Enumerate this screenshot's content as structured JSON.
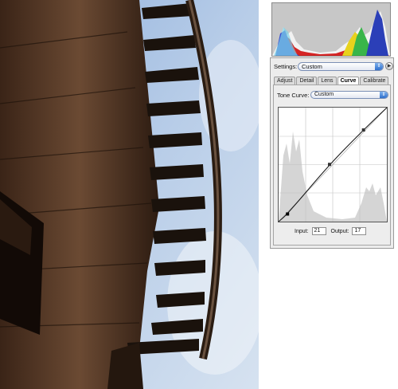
{
  "settings": {
    "label": "Settings:",
    "value": "Custom",
    "arrow_icon": "double-arrow-icon",
    "menu_icon": "play-icon"
  },
  "tabs": [
    {
      "label": "Adjust",
      "active": false
    },
    {
      "label": "Detail",
      "active": false
    },
    {
      "label": "Lens",
      "active": false
    },
    {
      "label": "Curve",
      "active": true
    },
    {
      "label": "Calibrate",
      "active": false
    }
  ],
  "tone_curve": {
    "label": "Tone Curve:",
    "value": "Custom"
  },
  "io": {
    "input_label": "Input:",
    "input_value": "21",
    "output_label": "Output:",
    "output_value": "17"
  },
  "curve_points": [
    {
      "input": 21,
      "output": 17
    },
    {
      "input": 120,
      "output": 128
    },
    {
      "input": 200,
      "output": 205
    }
  ],
  "colors": {
    "sky": "#a9c2e2",
    "wood": "#5a3d2a",
    "accent": "#2f6fcc"
  }
}
